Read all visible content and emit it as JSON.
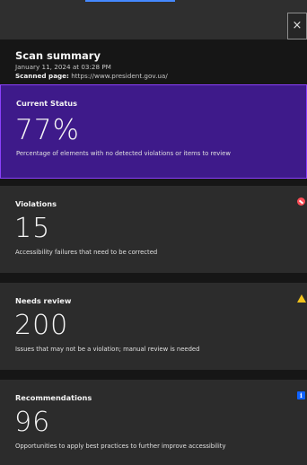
{
  "close": {
    "symbol": "×"
  },
  "header": {
    "title": "Scan summary",
    "date": "January 11, 2024 at 03:28 PM",
    "page_label": "Scanned page:",
    "page_url": "https://www.president.gov.ua/"
  },
  "status": {
    "label": "Current Status",
    "value": "77%",
    "description": "Percentage of elements with no detected violations or items to review"
  },
  "violations": {
    "label": "Violations",
    "value": "15",
    "description": "Accessibility failures that need to be corrected",
    "icon": "violation-icon"
  },
  "review": {
    "label": "Needs review",
    "value": "200",
    "description": "Issues that may not be a violation; manual review is needed",
    "icon": "warning-icon"
  },
  "recommendations": {
    "label": "Recommendations",
    "value": "96",
    "description": "Opportunities to apply best practices to further improve accessibility",
    "icon": "info-icon",
    "icon_glyph": "i"
  },
  "colors": {
    "status_bg": "#3e1a8a",
    "status_border": "#8a3ffc",
    "violation": "#fa4d56",
    "warning": "#f1c21b",
    "info": "#0f62fe"
  }
}
